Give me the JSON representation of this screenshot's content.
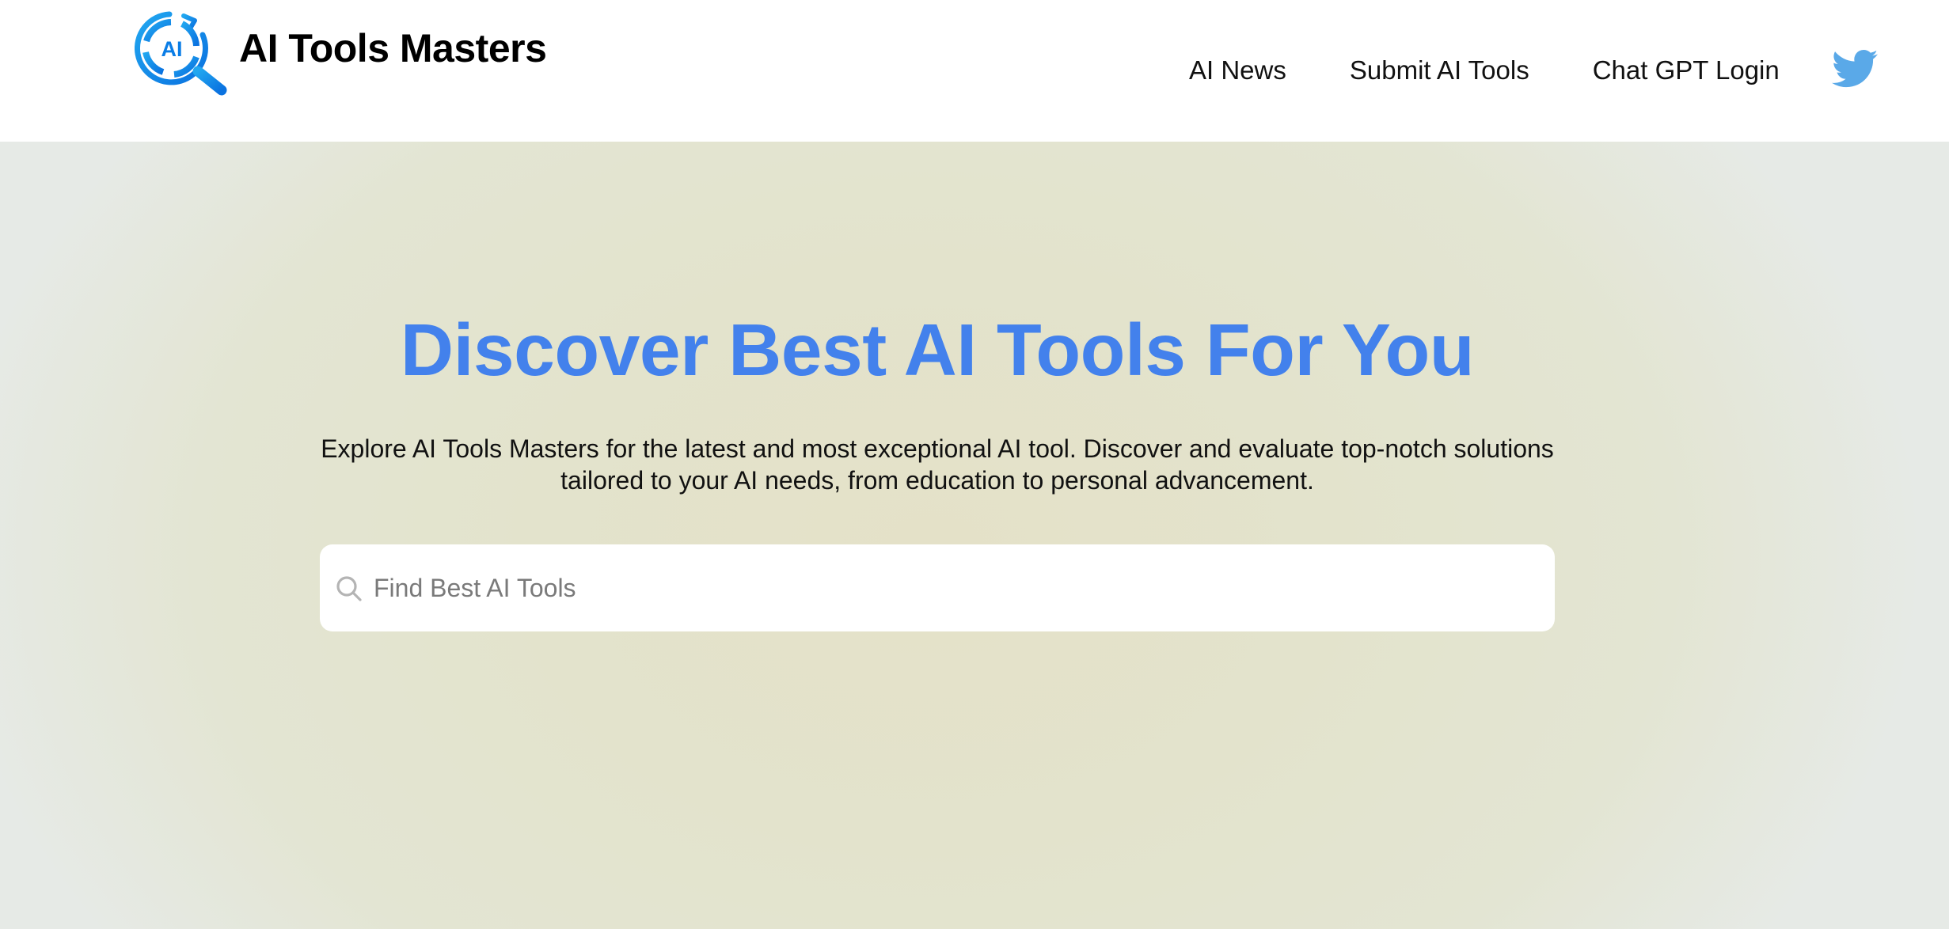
{
  "brand": {
    "name": "AI Tools Masters",
    "logo_mark_text": "AI",
    "accent_color": "#1a8fe8"
  },
  "nav": {
    "items": [
      {
        "label": "AI News"
      },
      {
        "label": "Submit AI Tools"
      },
      {
        "label": "Chat GPT Login"
      }
    ],
    "social_icon": "twitter-icon",
    "social_color": "#5aa9e8"
  },
  "hero": {
    "title": "Discover Best AI Tools For You",
    "title_color": "#4381ec",
    "description": "Explore AI Tools Masters for the latest and most exceptional AI tool. Discover and evaluate top-notch solutions tailored to your AI needs, from education to personal advancement."
  },
  "search": {
    "placeholder": "Find Best AI Tools",
    "value": "",
    "icon": "search-icon"
  }
}
